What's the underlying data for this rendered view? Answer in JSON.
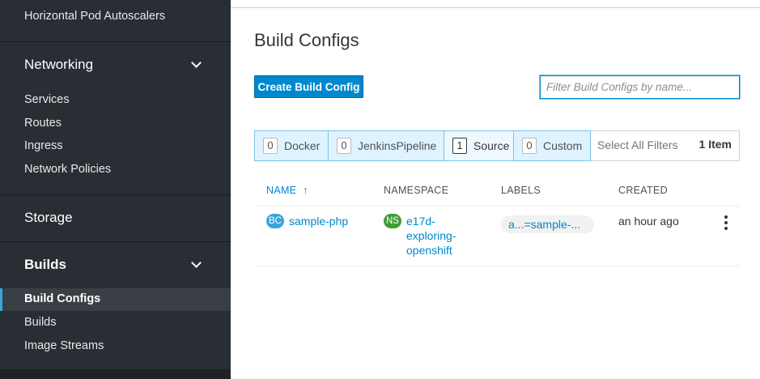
{
  "sidebar": {
    "top_item": "Horizontal Pod Autoscalers",
    "networking": {
      "title": "Networking",
      "items": [
        "Services",
        "Routes",
        "Ingress",
        "Network Policies"
      ]
    },
    "storage": {
      "title": "Storage"
    },
    "builds": {
      "title": "Builds",
      "active_item": "Build Configs",
      "items": [
        "Builds",
        "Image Streams"
      ]
    }
  },
  "page": {
    "title": "Build Configs",
    "create_button": "Create Build Config",
    "filter_placeholder": "Filter Build Configs by name..."
  },
  "filters": {
    "toggles": [
      {
        "count": "0",
        "label": "Docker"
      },
      {
        "count": "0",
        "label": "JenkinsPipeline"
      },
      {
        "count": "1",
        "label": "Source"
      },
      {
        "count": "0",
        "label": "Custom"
      }
    ],
    "select_all": "Select All Filters",
    "item_count": "1 Item"
  },
  "table": {
    "headers": [
      "NAME",
      "NAMESPACE",
      "LABELS",
      "CREATED"
    ],
    "sort_arrow": "↑",
    "rows": [
      {
        "name_badge": "BC",
        "name": "sample-php",
        "ns_badge": "NS",
        "namespace": "e17d-exploring-openshift",
        "label": "a...=sample-...",
        "created": "an hour ago"
      }
    ]
  },
  "colors": {
    "accent": "#0088ce",
    "sidebar_bg": "#292e34",
    "ns_badge": "#3f9c35",
    "bc_badge": "#39a5dc"
  },
  "icons": {
    "expand": "chevron-down-icon",
    "kebab": "kebab-menu-icon"
  }
}
